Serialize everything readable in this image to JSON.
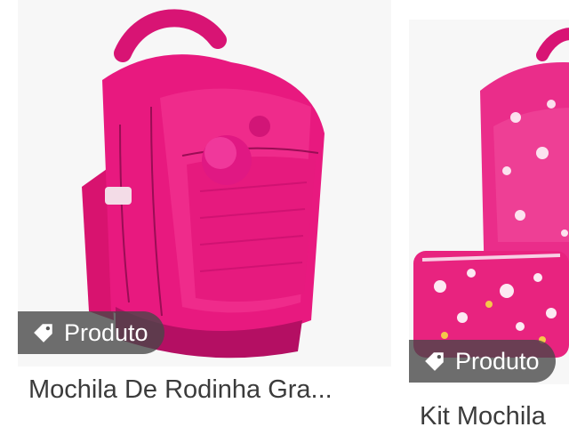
{
  "products": [
    {
      "badge_label": "Produto",
      "badge_icon": "tag-icon",
      "title": "Mochila De Rodinha Gra...",
      "colors": {
        "main": "#e8197f",
        "dark": "#c0106a",
        "light": "#f24fa6"
      }
    },
    {
      "badge_label": "Produto",
      "badge_icon": "tag-icon",
      "title": "Kit Mochila",
      "colors": {
        "main": "#ea2d8a",
        "pattern": "#ffffff"
      }
    }
  ],
  "colors": {
    "badge_bg": "#464646",
    "title_text": "#3b3b3b"
  }
}
